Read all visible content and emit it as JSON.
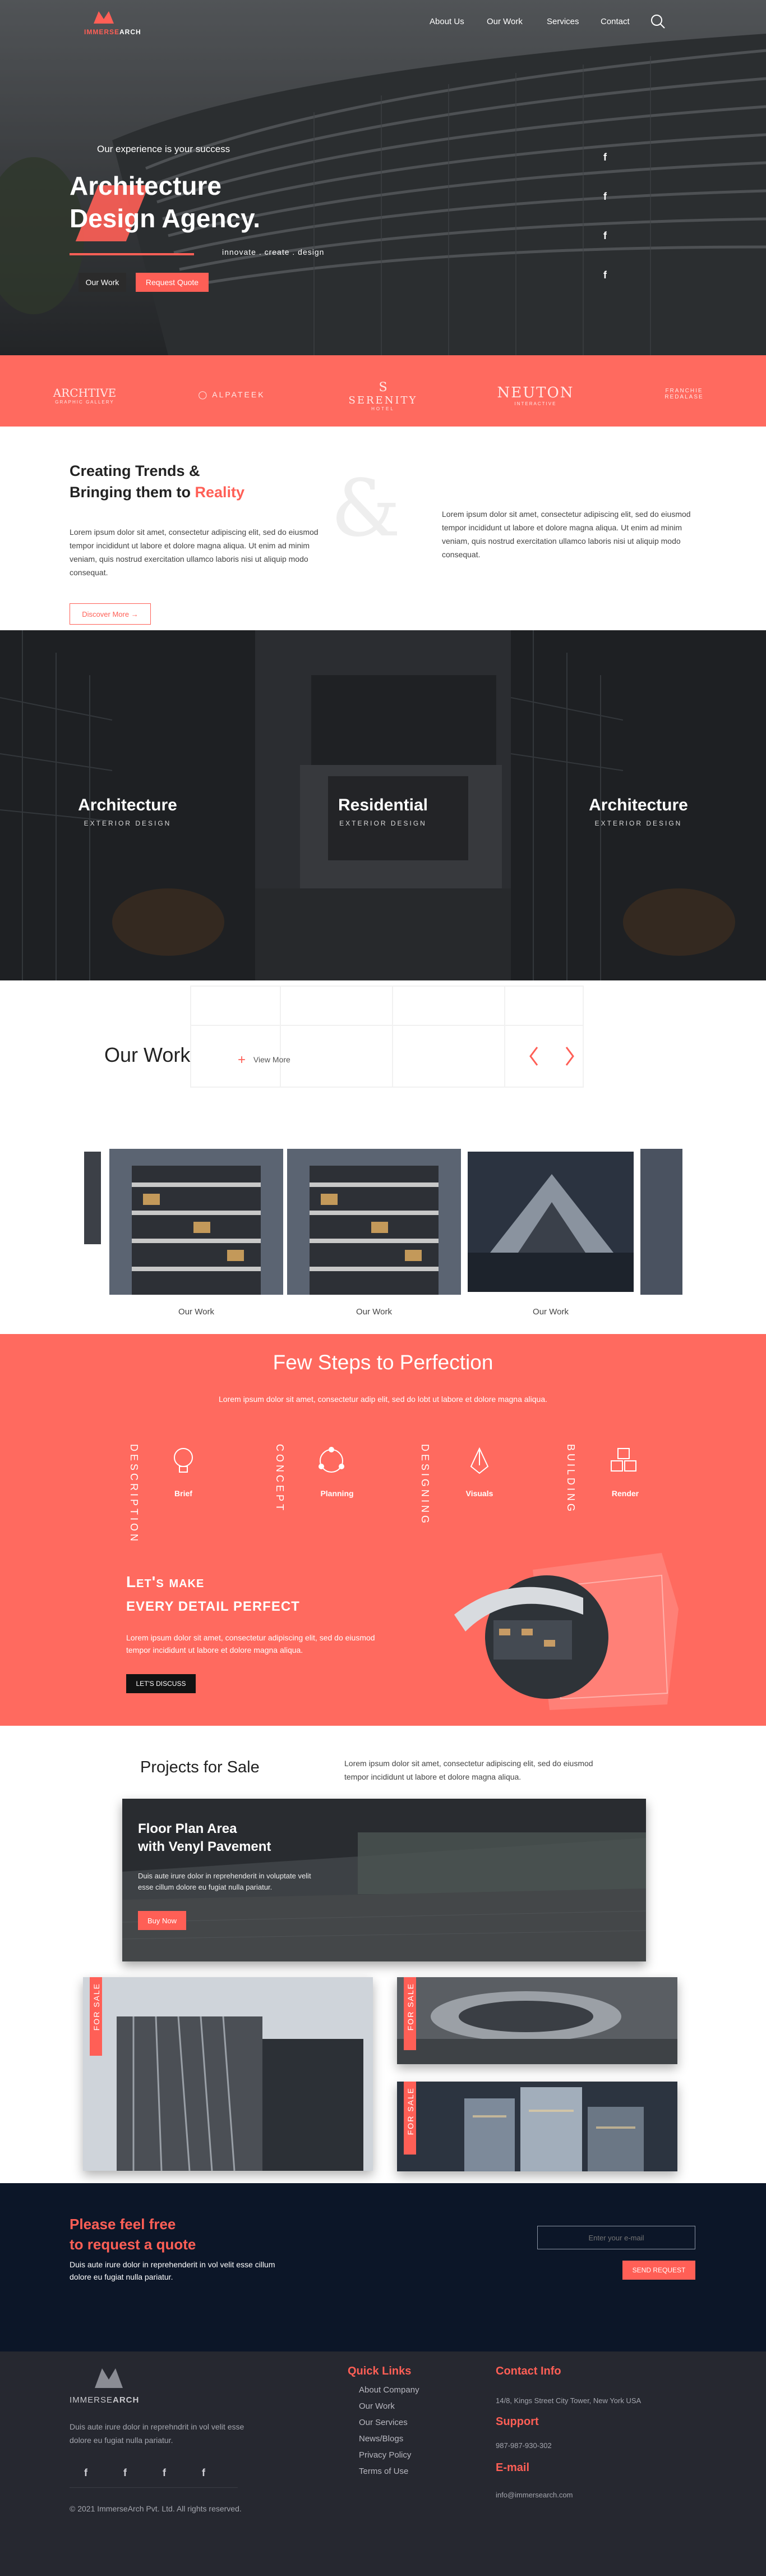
{
  "brand": {
    "name_part1": "IMMERSE",
    "name_part2": "ARCH"
  },
  "nav": {
    "items": [
      "About Us",
      "Our Work",
      "Services",
      "Contact"
    ]
  },
  "hero": {
    "subtitle": "Our experience is your success",
    "title_line1": "Architecture",
    "title_line2": "Design Agency.",
    "tagline": "innovate . create . design",
    "btn_work": "Our Work",
    "btn_quote": "Request Quote"
  },
  "social_icon": "f",
  "brands": {
    "b1": "ARCHTIVE",
    "b1_sub": "GRAPHIC GALLERY",
    "b2": "ALPATEEK",
    "b3": "SERENITY",
    "b3_sub": "HOTEL",
    "b4": "NEUTON",
    "b4_sub": "INTERACTIVE",
    "b5": "FRANCHIE",
    "b5_sub": "REDALASE"
  },
  "intro": {
    "title_line1": "Creating Trends &",
    "title_line2_prefix": "Bringing them to ",
    "title_accent": "Reality",
    "left_text": "Lorem ipsum dolor sit amet, consectetur adipiscing elit, sed do eiusmod tempor incididunt ut labore et dolore magna aliqua. Ut enim ad minim veniam, quis nostrud exercitation ullamco laboris nisi ut aliquip modo consequat.",
    "right_text": "Lorem ipsum dolor sit amet, consectetur adipiscing elit, sed do eiusmod tempor incididunt ut labore et dolore magna aliqua. Ut enim ad minim veniam, quis nostrud exercitation ullamco laboris nisi ut aliquip modo consequat.",
    "discover": "Discover More →",
    "amp": "&"
  },
  "categories": [
    {
      "title": "Architecture",
      "sub": "EXTERIOR DESIGN"
    },
    {
      "title": "Residential",
      "sub": "EXTERIOR DESIGN"
    },
    {
      "title": "Architecture",
      "sub": "EXTERIOR DESIGN"
    }
  ],
  "work": {
    "title": "Our Work",
    "view_more": "View More",
    "labels": [
      "Our Work",
      "Our Work",
      "Our Work"
    ]
  },
  "steps": {
    "title": "Few Steps to Perfection",
    "intro": "Lorem ipsum dolor sit amet, consectetur adip elit, sed do lobt ut labore et dolore magna aliqua.",
    "vertical": [
      "DESCRIPTION",
      "CONCEPT",
      "DESIGNING",
      "BUILDING"
    ],
    "labels": [
      "Brief",
      "Planning",
      "Visuals",
      "Render"
    ],
    "heading1": "Let's make",
    "heading2": "every detail perfect",
    "text": "Lorem ipsum dolor sit amet, consectetur adipiscing elit, sed do eiusmod tempor incididunt ut labore et dolore magna aliqua.",
    "btn": "LET'S DISCUSS"
  },
  "projects": {
    "title": "Projects for Sale",
    "intro": "Lorem ipsum dolor sit amet, consectetur adipiscing elit, sed do eiusmod tempor incididunt ut labore et dolore magna aliqua.",
    "featured_title1": "Floor Plan Area",
    "featured_title2": "with Venyl Pavement",
    "featured_text": "Duis aute irure dolor in reprehenderit in voluptate velit esse cillum dolore eu fugiat nulla pariatur.",
    "buy": "Buy Now",
    "for_sale": "FOR SALE"
  },
  "quote": {
    "title1": "Please feel free",
    "title2": "to request a quote",
    "text": "Duis aute irure dolor in reprehenderit in vol velit esse cillum dolore eu fugiat nulla pariatur.",
    "email_placeholder": "Enter your e-mail",
    "send": "SEND REQUEST"
  },
  "footer": {
    "about": "Duis aute irure dolor in reprehndrit in vol velit esse dolore eu fugiat nulla pariatur.",
    "copyright": "© 2021 ImmerseArch Pvt. Ltd. All rights reserved.",
    "quick_links_title": "Quick Links",
    "links": [
      "About Company",
      "Our Work",
      "Our Services",
      "News/Blogs",
      "Privacy Policy",
      "Terms of Use"
    ],
    "contact_title": "Contact Info",
    "address": "14/8, Kings Street City Tower, New York USA",
    "support_title": "Support",
    "phone": "987-987-930-302",
    "email_title": "E-mail",
    "email": "info@immersearch.com"
  },
  "colors": {
    "accent": "#ff5f56",
    "dark": "#0c1628",
    "footer": "#262830"
  }
}
